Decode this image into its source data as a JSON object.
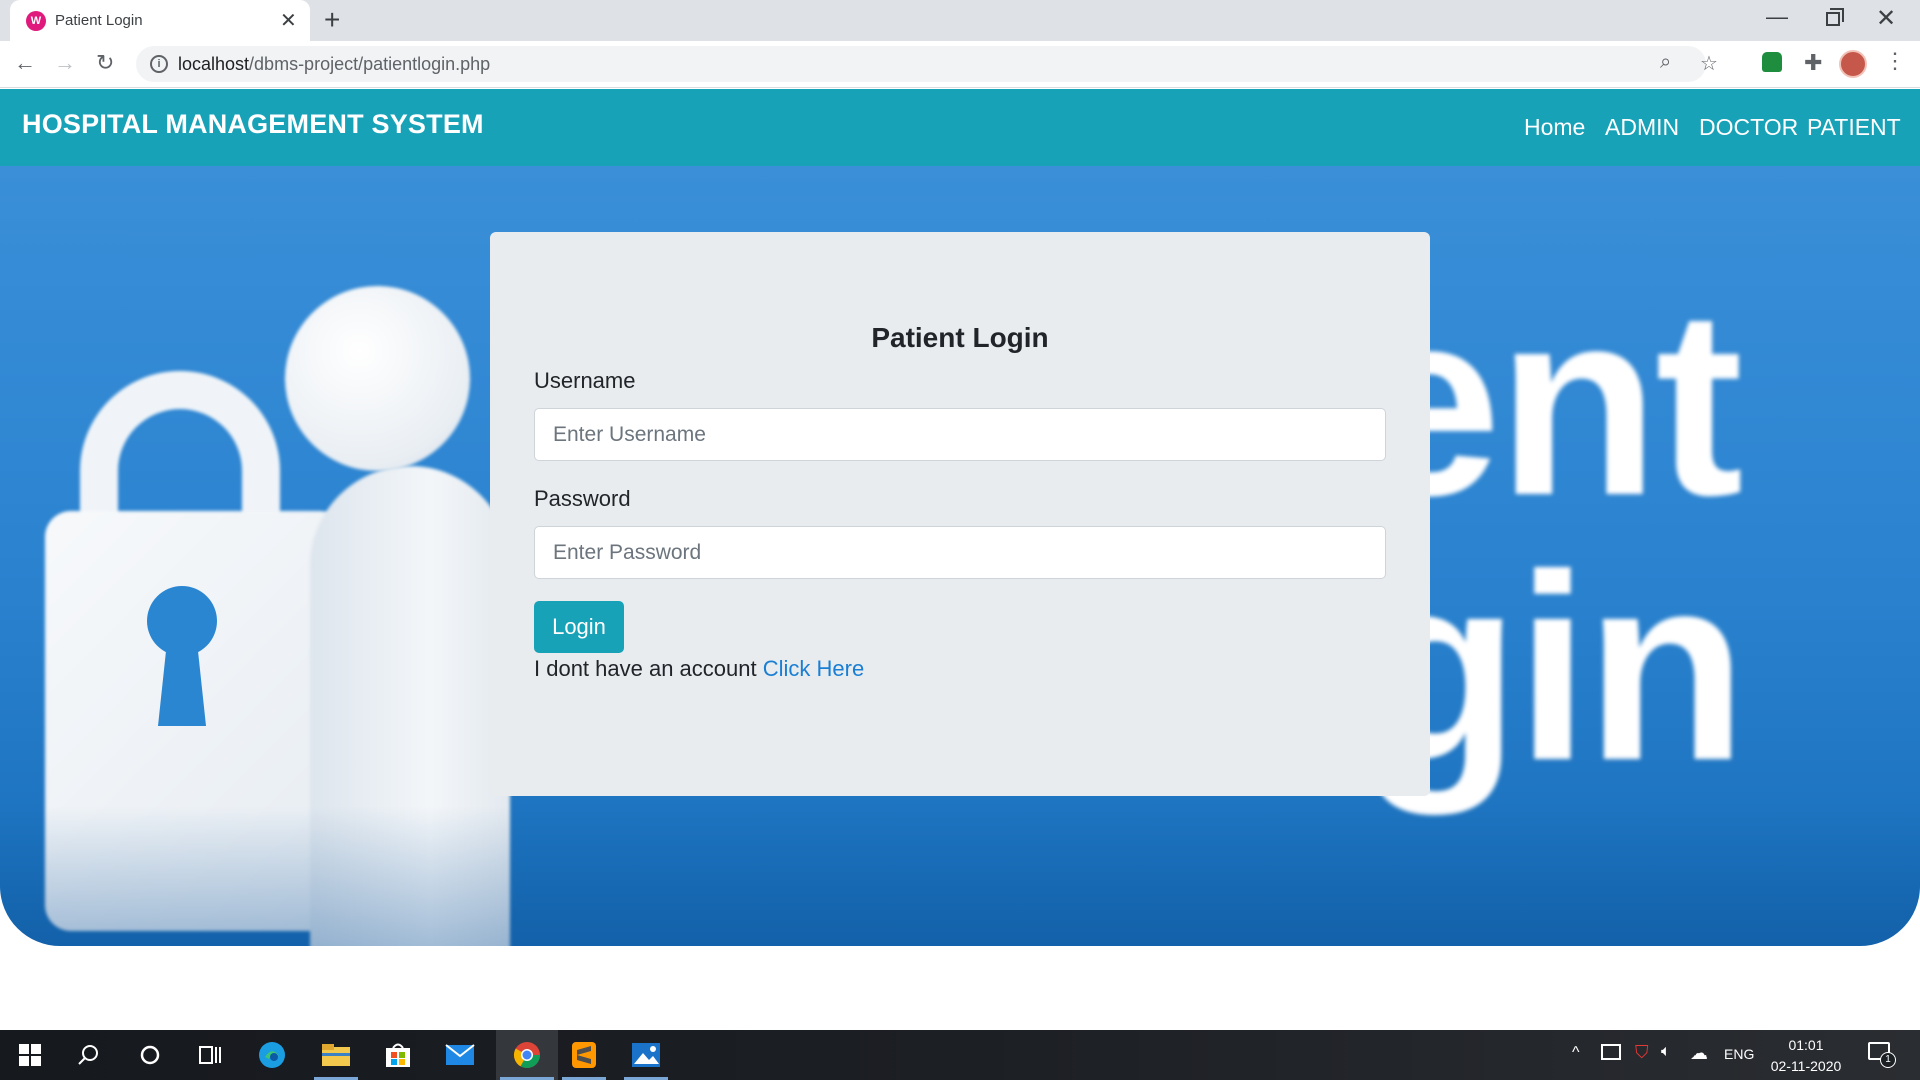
{
  "browser": {
    "tab_title": "Patient Login",
    "tab_favicon_letter": "W",
    "url_host": "localhost",
    "url_path": "/dbms-project/patientlogin.php"
  },
  "navbar": {
    "brand": "HOSPITAL MANAGEMENT SYSTEM",
    "links": [
      "Home",
      "ADMIN",
      "DOCTOR",
      "PATIENT"
    ]
  },
  "hero": {
    "line1": "tient",
    "line2": "ogin"
  },
  "login_form": {
    "title": "Patient Login",
    "username_label": "Username",
    "username_placeholder": "Enter Username",
    "password_label": "Password",
    "password_placeholder": "Enter Password",
    "login_button": "Login",
    "signup_text": "I dont have an account",
    "signup_link": "Click Here"
  },
  "taskbar": {
    "language": "ENG",
    "time": "01:01",
    "date": "02-11-2020",
    "notification_count": "1"
  },
  "colors": {
    "navbar": "#17a2b8",
    "card": "#e9ecef",
    "link": "#1a7fd4",
    "button": "#17a2b8"
  }
}
